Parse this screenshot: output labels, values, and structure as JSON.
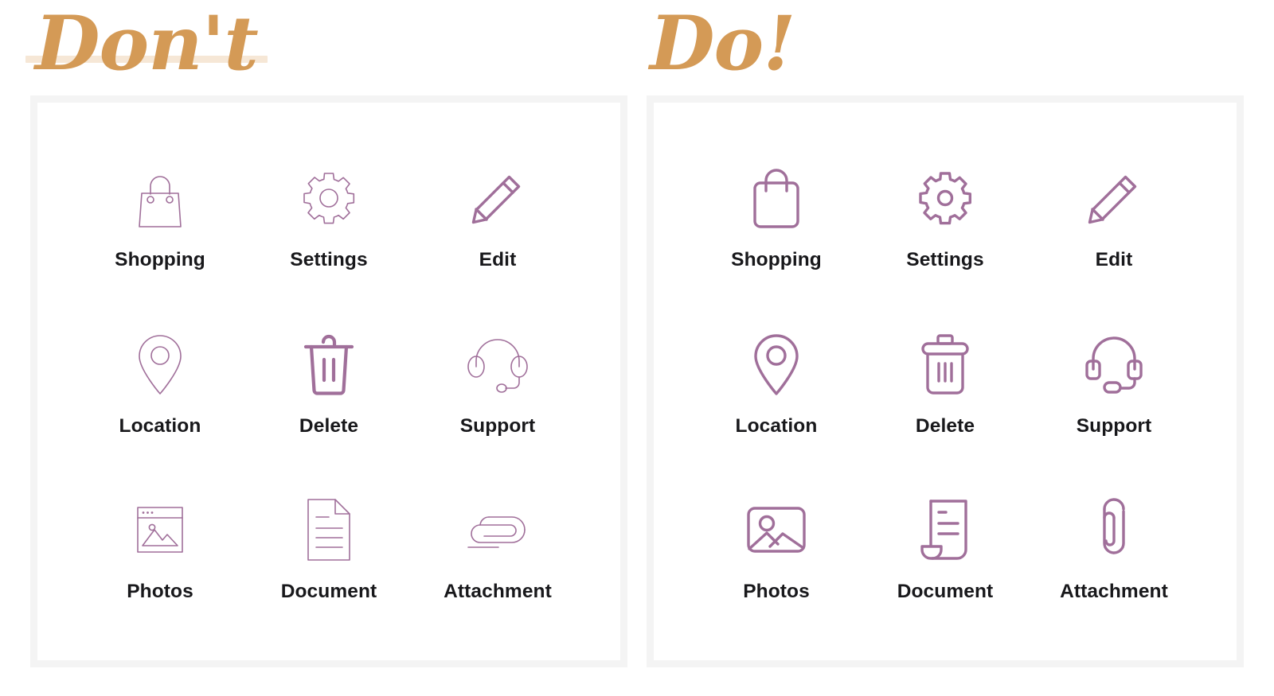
{
  "accent_gold": "#d49a56",
  "strike_color": "#f6e7d6",
  "icon_color": "#a06f9a",
  "panel_border": "#f4f4f4",
  "label_color": "#18181b",
  "background": "#ffffff",
  "columns": [
    {
      "id": "dont",
      "title": "Don't",
      "strike_through": true,
      "items": [
        {
          "icon": "shopping-bag-icon",
          "label": "Shopping"
        },
        {
          "icon": "gear-icon",
          "label": "Settings"
        },
        {
          "icon": "pencil-icon",
          "label": "Edit"
        },
        {
          "icon": "map-pin-icon",
          "label": "Location"
        },
        {
          "icon": "trash-icon",
          "label": "Delete"
        },
        {
          "icon": "headset-icon",
          "label": "Support"
        },
        {
          "icon": "photo-window-icon",
          "label": "Photos"
        },
        {
          "icon": "document-icon",
          "label": "Document"
        },
        {
          "icon": "paperclip-icon",
          "label": "Attachment"
        }
      ]
    },
    {
      "id": "do",
      "title": "Do!",
      "strike_through": false,
      "items": [
        {
          "icon": "shopping-bag-icon",
          "label": "Shopping"
        },
        {
          "icon": "gear-icon",
          "label": "Settings"
        },
        {
          "icon": "pencil-icon",
          "label": "Edit"
        },
        {
          "icon": "map-pin-icon",
          "label": "Location"
        },
        {
          "icon": "trash-icon",
          "label": "Delete"
        },
        {
          "icon": "headset-icon",
          "label": "Support"
        },
        {
          "icon": "photo-frame-icon",
          "label": "Photos"
        },
        {
          "icon": "scroll-document-icon",
          "label": "Document"
        },
        {
          "icon": "paperclip-icon",
          "label": "Attachment"
        }
      ]
    }
  ]
}
